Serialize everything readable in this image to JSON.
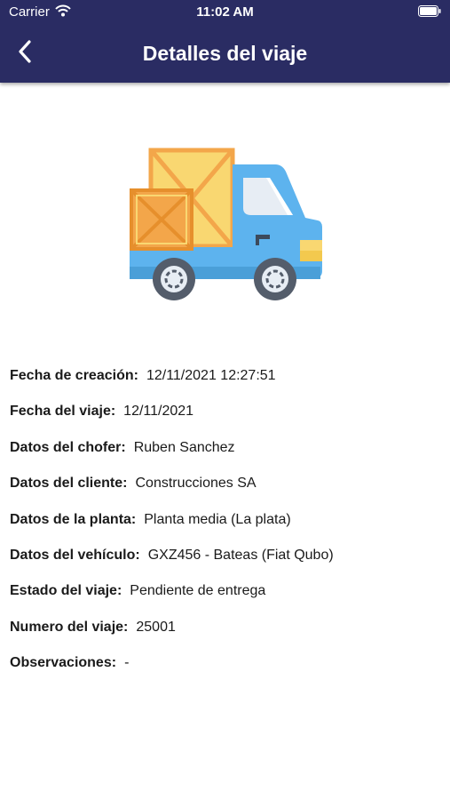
{
  "status_bar": {
    "carrier": "Carrier",
    "time": "11:02 AM"
  },
  "header": {
    "title": "Detalles del viaje",
    "back_icon": "chevron-left-icon"
  },
  "illustration": {
    "name": "delivery-truck-icon",
    "colors": {
      "truck": "#5db3ee",
      "box": "#f3a64a",
      "box_light": "#f9d771",
      "wheel": "#545d6b"
    }
  },
  "details": [
    {
      "label": "Fecha de creación:",
      "value": "12/11/2021 12:27:51"
    },
    {
      "label": "Fecha del viaje:",
      "value": "12/11/2021"
    },
    {
      "label": "Datos del chofer:",
      "value": "Ruben Sanchez"
    },
    {
      "label": "Datos del cliente:",
      "value": "Construcciones SA"
    },
    {
      "label": "Datos de la planta:",
      "value": "Planta media (La plata)"
    },
    {
      "label": "Datos del vehículo:",
      "value": "GXZ456 - Bateas (Fiat Qubo)"
    },
    {
      "label": "Estado del viaje:",
      "value": "Pendiente de entrega"
    },
    {
      "label": "Numero del viaje:",
      "value": "25001"
    },
    {
      "label": "Observaciones:",
      "value": "-"
    }
  ],
  "colors": {
    "header_bg": "#2a2c63",
    "header_text": "#ffffff"
  }
}
